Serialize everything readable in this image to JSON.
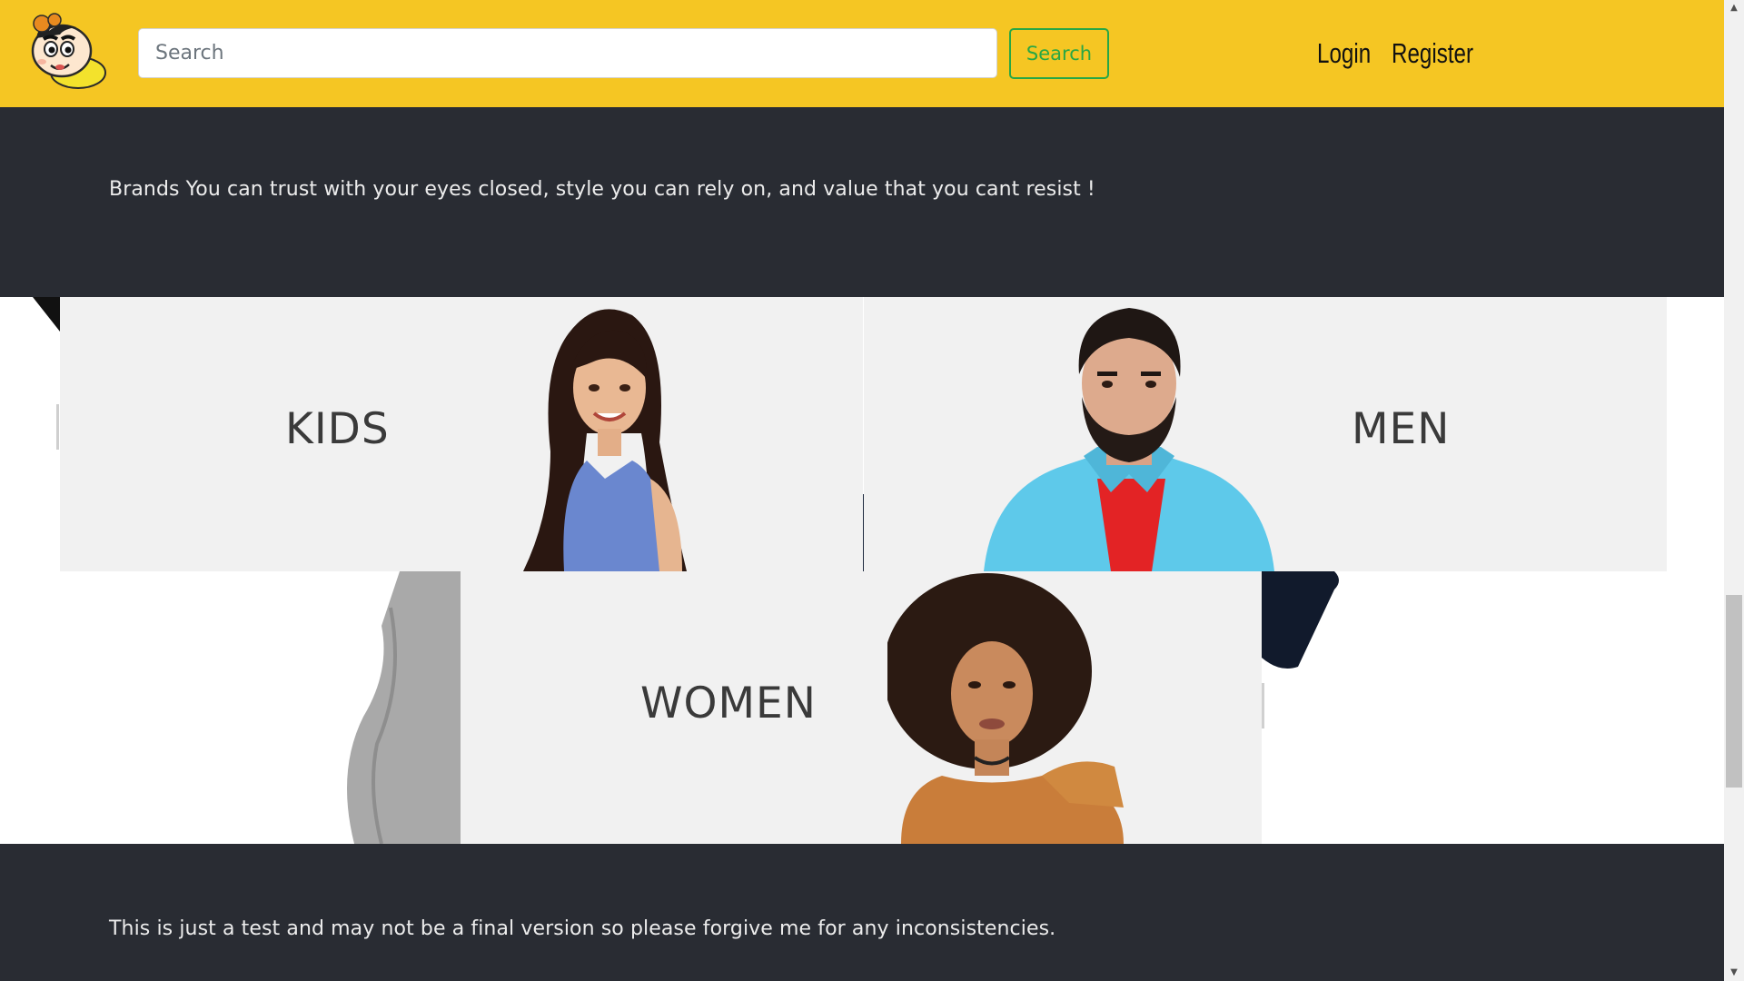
{
  "header": {
    "logo_icon": "cartoon-boy-logo",
    "search": {
      "placeholder": "Search",
      "value": ""
    },
    "search_button": "Search",
    "nav": {
      "login": "Login",
      "register": "Register"
    }
  },
  "hero": {
    "tagline": "Brands You can trust with your eyes closed, style you can rely on, and value that you cant resist !"
  },
  "categories": [
    {
      "label": "KIDS"
    },
    {
      "label": "MEN"
    },
    {
      "label": "WOMEN"
    }
  ],
  "footer": {
    "note": "This is just a test and may not be a final version so please forgive me for any inconsistencies."
  },
  "colors": {
    "navbar": "#f5c623",
    "dark_band": "#292c33",
    "accent_green": "#28a745",
    "banner_bg": "#f1f1f1"
  }
}
